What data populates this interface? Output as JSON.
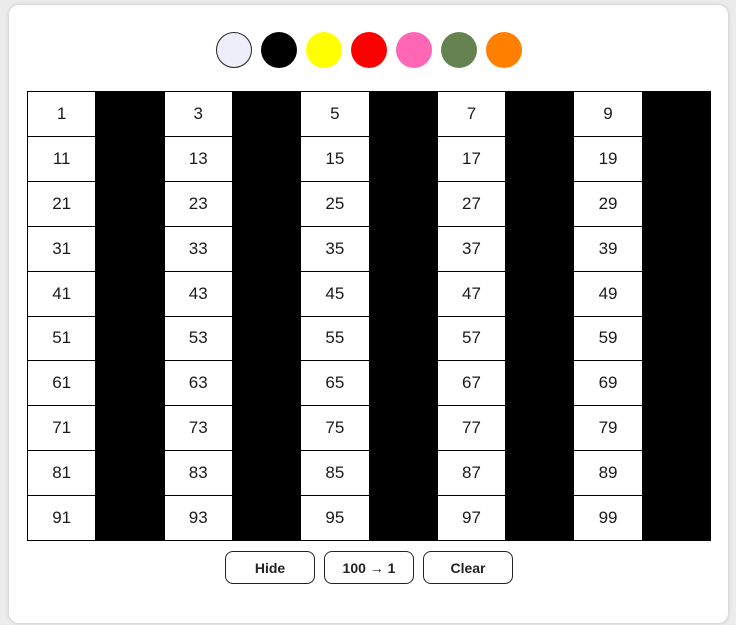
{
  "palette": {
    "selected_index": 0,
    "swatches": [
      {
        "name": "lavender",
        "color": "#eeedfa"
      },
      {
        "name": "black",
        "color": "#000000"
      },
      {
        "name": "yellow",
        "color": "#ffff00"
      },
      {
        "name": "red",
        "color": "#ff0000"
      },
      {
        "name": "pink",
        "color": "#ff66b3"
      },
      {
        "name": "olive-green",
        "color": "#658350"
      },
      {
        "name": "orange",
        "color": "#ff7f00"
      }
    ]
  },
  "grid": {
    "rows": 10,
    "columns": 10,
    "start": 1,
    "end": 100,
    "fill_color": "#000000",
    "filled_numbers": [
      2,
      4,
      6,
      8,
      10,
      12,
      14,
      16,
      18,
      20,
      22,
      24,
      26,
      28,
      30,
      32,
      34,
      36,
      38,
      40,
      42,
      44,
      46,
      48,
      50,
      52,
      54,
      56,
      58,
      60,
      62,
      64,
      66,
      68,
      70,
      72,
      74,
      76,
      78,
      80,
      82,
      84,
      86,
      88,
      90,
      92,
      94,
      96,
      98,
      100
    ]
  },
  "buttons": {
    "hide_label": "Hide",
    "order_label": "100 → 1",
    "clear_label": "Clear"
  }
}
